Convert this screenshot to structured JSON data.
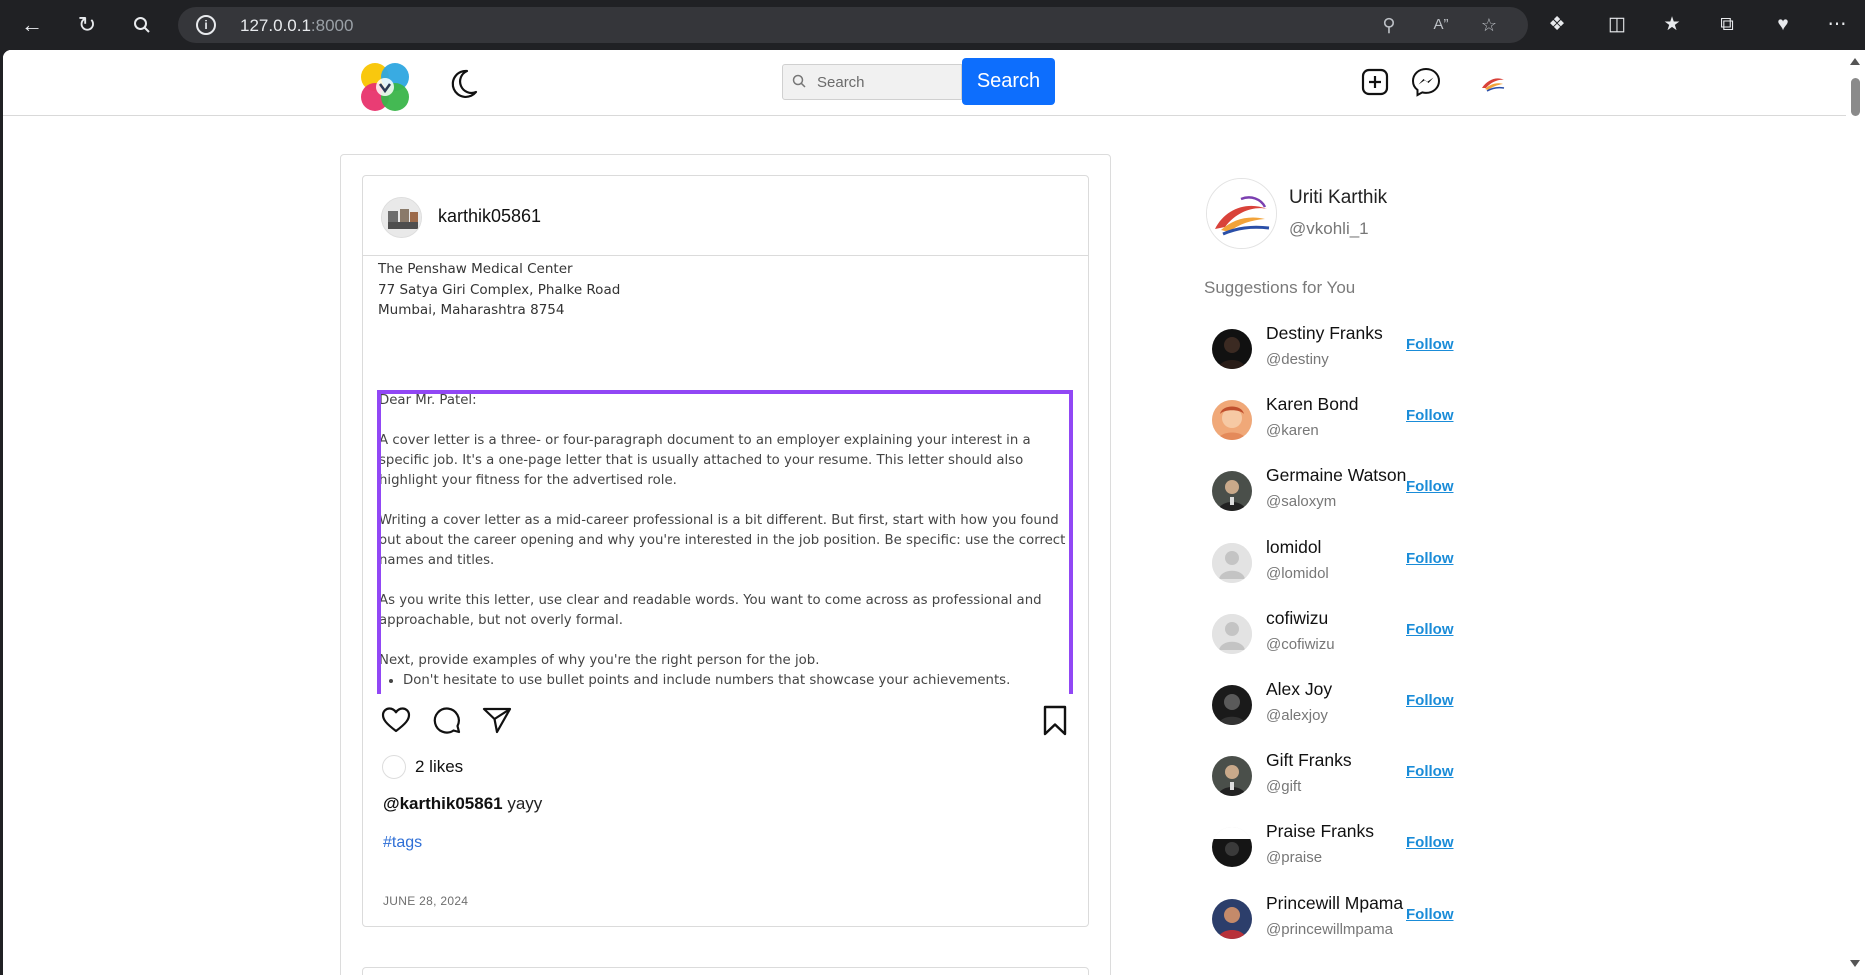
{
  "browser": {
    "url_host": "127.0.0.1",
    "url_port": ":8000"
  },
  "header": {
    "search_placeholder": "Search",
    "search_button": "Search"
  },
  "post": {
    "username": "karthik05861",
    "image_text": {
      "address": [
        "The Penshaw Medical Center",
        "77 Satya Giri Complex, Phalke Road",
        "Mumbai, Maharashtra 8754"
      ],
      "salutation": "Dear Mr. Patel:",
      "paragraphs": [
        "A cover letter is a three- or four-paragraph document to an employer explaining your interest in a specific job. It's a one-page letter that is usually attached to your resume. This letter should also highlight your fitness for the advertised role.",
        "Writing a cover letter as a mid-career professional is a bit different. But first, start with how you found out about the career opening and why you're interested in the job position. Be specific: use the correct names and titles.",
        "As you write this letter, use clear and readable words. You want to come across as professional and approachable, but not overly formal.",
        "Next, provide examples of why you're the right person for the job."
      ],
      "bullet": "Don't hesitate to use bullet points and include numbers that showcase your achievements."
    },
    "likes": "2 likes",
    "caption_user": "@karthik05861",
    "caption_text": "yayy",
    "tags": "#tags",
    "date": "JUNE 28, 2024"
  },
  "sidebar": {
    "profile_name": "Uriti Karthik",
    "profile_handle": "@vkohli_1",
    "suggestions_title": "Suggestions for You",
    "follow_label": "Follow",
    "suggestions": [
      {
        "name": "Destiny Franks",
        "handle": "@destiny"
      },
      {
        "name": "Karen Bond",
        "handle": "@karen"
      },
      {
        "name": "Germaine Watson",
        "handle": "@saloxym"
      },
      {
        "name": "lomidol",
        "handle": "@lomidol"
      },
      {
        "name": "cofiwizu",
        "handle": "@cofiwizu"
      },
      {
        "name": "Alex Joy",
        "handle": "@alexjoy"
      },
      {
        "name": "Gift Franks",
        "handle": "@gift"
      },
      {
        "name": "Praise Franks",
        "handle": "@praise"
      },
      {
        "name": "Princewill Mpama",
        "handle": "@princewillmpama"
      }
    ]
  },
  "colors": {
    "primary_button": "#0d6efd",
    "follow_link": "#1a8cd8",
    "selection_border": "#9147f5",
    "tag_link": "#2f6fd6"
  }
}
